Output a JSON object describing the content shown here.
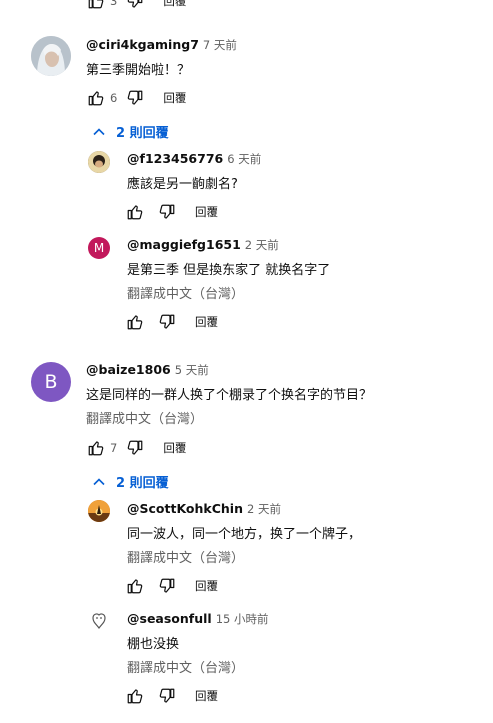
{
  "reply_label": "回覆",
  "translate_label": "翻譯成中文（台灣）",
  "top_partial": {
    "like_count": "3"
  },
  "comments": [
    {
      "handle": "@ciri4kgaming7",
      "time": "7 天前",
      "text": "第三季開始啦！？",
      "like_count": "6",
      "replies_toggle": "2 則回覆",
      "replies": [
        {
          "handle": "@f123456776",
          "time": "6 天前",
          "text": "應該是另一齣劇名?",
          "like_count": ""
        },
        {
          "handle": "@maggiefg1651",
          "time": "2 天前",
          "avatar_letter": "M",
          "text": "是第三季 但是換东家了 就换名字了",
          "like_count": ""
        }
      ]
    },
    {
      "handle": "@baize1806",
      "time": "5 天前",
      "avatar_letter": "B",
      "text": "这是同样的一群人换了个棚录了个换名字的节目？",
      "like_count": "7",
      "replies_toggle": "2 則回覆",
      "replies": [
        {
          "handle": "@ScottKohkChin",
          "time": "2 天前",
          "text": "同一波人，同一个地方，换了一个牌子，",
          "like_count": ""
        },
        {
          "handle": "@seasonfull",
          "time": "15 小時前",
          "text": "棚也没换",
          "like_count": ""
        }
      ]
    }
  ],
  "colors": {
    "link_blue": "#065fd4",
    "secondary_text": "#606060",
    "avatar_m": "#c2185b",
    "avatar_b": "#7e57c2"
  }
}
